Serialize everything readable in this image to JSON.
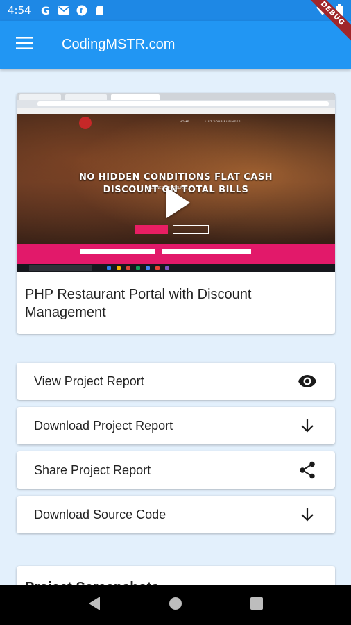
{
  "status_bar": {
    "time": "4:54",
    "icons": [
      "google-icon",
      "gmail-icon",
      "app-notification-icon",
      "sd-card-icon",
      "wifi-icon",
      "battery-icon"
    ]
  },
  "debug_banner": "DEBUG",
  "app_bar": {
    "title": "CodingMSTR.com",
    "menu_icon": "hamburger-menu-icon"
  },
  "project": {
    "thumbnail": {
      "hero_line_1": "NO HIDDEN CONDITIONS FLAT CASH",
      "hero_line_2": "DISCOUNT ON TOTAL BILLS",
      "play_icon": "play-icon"
    },
    "title": "PHP Restaurant Portal with Discount Management"
  },
  "actions": [
    {
      "label": "View Project Report",
      "icon": "eye-icon"
    },
    {
      "label": "Download Project Report",
      "icon": "arrow-down-icon"
    },
    {
      "label": "Share Project Report",
      "icon": "share-icon"
    },
    {
      "label": "Download Source Code",
      "icon": "arrow-down-icon"
    }
  ],
  "screenshots": {
    "title": "Project Screenshots"
  },
  "colors": {
    "app_bar": "#2196f3",
    "status_bar": "#1e88e5",
    "background": "#e3f0fc",
    "debug_banner": "#a0262a"
  }
}
